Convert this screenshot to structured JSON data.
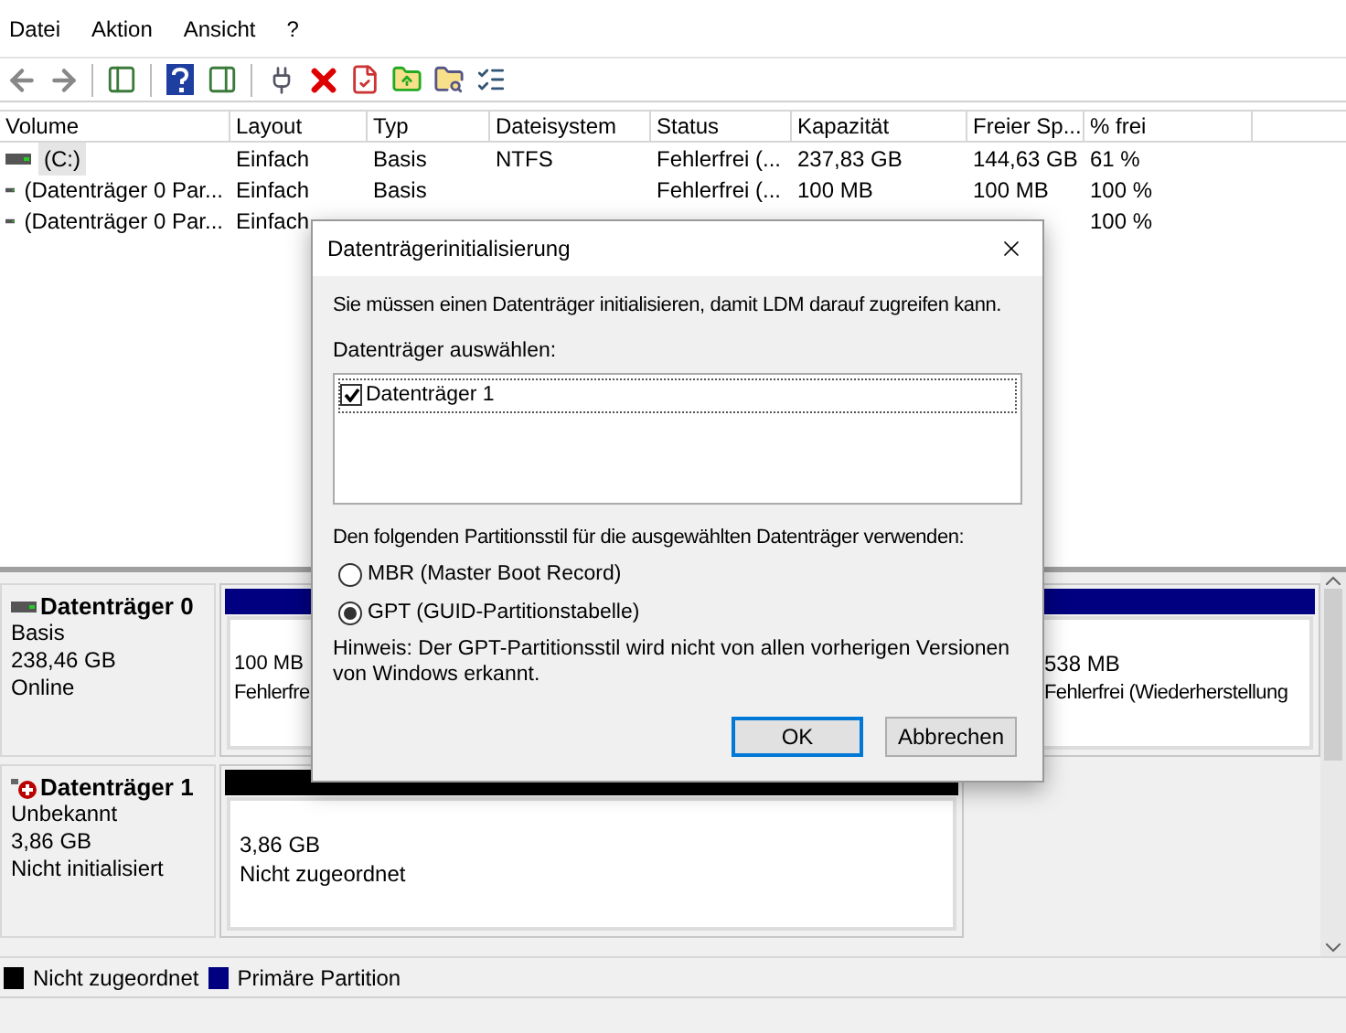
{
  "menu": [
    {
      "label": "Datei"
    },
    {
      "label": "Aktion"
    },
    {
      "label": "Ansicht"
    },
    {
      "label": "?"
    }
  ],
  "table": {
    "columns": [
      "Volume",
      "Layout",
      "Typ",
      "Dateisystem",
      "Status",
      "Kapazität",
      "Freier Sp...",
      "% frei"
    ],
    "rows": [
      {
        "selected": true,
        "cells": [
          "(C:)",
          "Einfach",
          "Basis",
          "NTFS",
          "Fehlerfrei (...",
          "237,83 GB",
          "144,63 GB",
          "61 %"
        ]
      },
      {
        "selected": false,
        "cells": [
          "(Datenträger 0 Par...",
          "Einfach",
          "Basis",
          null,
          "Fehlerfrei (...",
          "100 MB",
          "100 MB",
          "100 %"
        ]
      },
      {
        "selected": false,
        "cells": [
          "(Datenträger 0 Par...",
          "Einfach",
          null,
          null,
          null,
          null,
          null,
          "100 %"
        ]
      }
    ]
  },
  "disks": [
    {
      "name": "Datenträger 0",
      "kind": "online",
      "type": "Basis",
      "size": "238,46 GB",
      "status": "Online",
      "partitions": [
        {
          "size": "100 MB",
          "status": "Fehlerfre",
          "color": "#000080"
        },
        {
          "size": "538 MB",
          "status": "Fehlerfrei (Wiederherstellung",
          "color": "#000080"
        }
      ]
    },
    {
      "name": "Datenträger 1",
      "kind": "error",
      "type": "Unbekannt",
      "size": "3,86 GB",
      "status": "Nicht initialisiert",
      "partitions": [
        {
          "size": "3,86 GB",
          "status": "Nicht zugeordnet",
          "color": "#000000"
        }
      ]
    }
  ],
  "legend": [
    {
      "label": "Nicht zugeordnet",
      "color": "#000000"
    },
    {
      "label": "Primäre Partition",
      "color": "#000080"
    }
  ],
  "dialog": {
    "title": "Datenträgerinitialisierung",
    "message": "Sie müssen einen Datenträger initialisieren, damit LDM darauf zugreifen kann.",
    "list_label": "Datenträger auswählen:",
    "disks": [
      {
        "label": "Datenträger 1",
        "checked": true
      }
    ],
    "style_label": "Den folgenden Partitionsstil für die ausgewählten Datenträger verwenden:",
    "options": [
      {
        "label": "MBR (Master Boot Record)",
        "selected": false
      },
      {
        "label": "GPT (GUID-Partitionstabelle)",
        "selected": true
      }
    ],
    "note": "Hinweis: Der GPT-Partitionsstil wird nicht von allen vorherigen Versionen von Windows erkannt.",
    "buttons": [
      {
        "label": "OK",
        "default": true
      },
      {
        "label": "Abbrechen",
        "default": false
      }
    ]
  }
}
